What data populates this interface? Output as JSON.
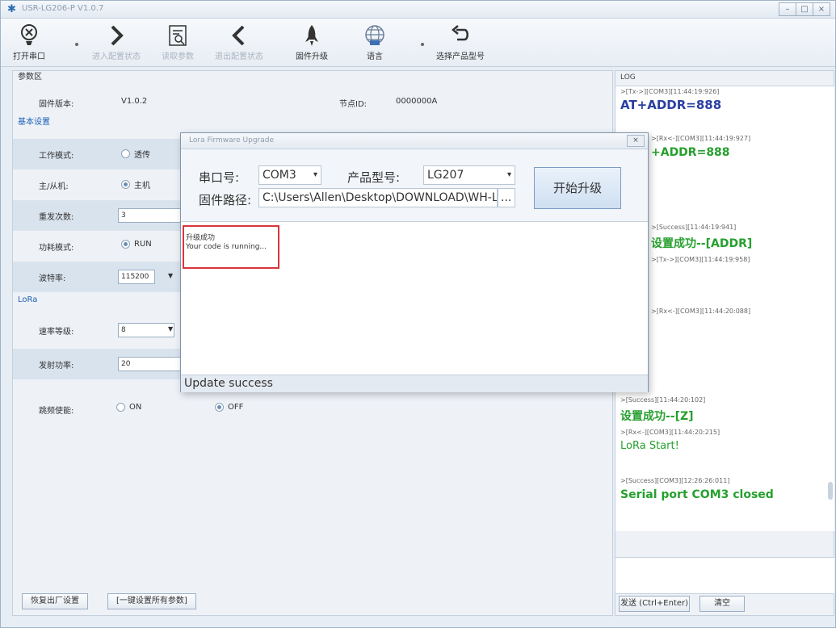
{
  "window": {
    "title": "USR-LG206-P V1.0.7",
    "buttons": [
      "–",
      "□",
      "×"
    ]
  },
  "toolbar": {
    "items": [
      {
        "label": "打开串口",
        "icon": "serial-port-icon",
        "enabled": true
      },
      {
        "label": "进入配置状态",
        "icon": "chevron-right-icon",
        "enabled": false
      },
      {
        "label": "读取参数",
        "icon": "read-params-icon",
        "enabled": false
      },
      {
        "label": "退出配置状态",
        "icon": "chevron-left-icon",
        "enabled": false
      },
      {
        "label": "固件升级",
        "icon": "rocket-icon",
        "enabled": true
      },
      {
        "label": "语言",
        "icon": "globe-icon",
        "enabled": true
      },
      {
        "label": "选择产品型号",
        "icon": "return-arrow-icon",
        "enabled": true
      }
    ]
  },
  "params": {
    "section_title": "参数区",
    "firmware_label": "固件版本:",
    "firmware_value": "V1.0.2",
    "node_id_label": "节点ID:",
    "node_id_value": "0000000A"
  },
  "basic": {
    "section_title": "基本设置",
    "work_mode_label": "工作模式:",
    "work_mode_option": "透传",
    "master_slave_label": "主/从机:",
    "master_option": "主机",
    "retry_label": "重发次数:",
    "retry_value": "3",
    "power_mode_label": "功耗模式:",
    "power_mode_option": "RUN",
    "baud_label": "波特率:",
    "baud_value": "115200"
  },
  "lora": {
    "section_title": "LoRa",
    "speed_label": "速率等级:",
    "speed_value": "8",
    "tx_power_label": "发射功率:",
    "tx_power_value": "20",
    "fh_label": "跳频使能:",
    "fh_on": "ON",
    "fh_off": "OFF"
  },
  "bottom_buttons": {
    "factory": "恢复出厂设置",
    "set_all": "[一键设置所有参数]"
  },
  "log": {
    "header": "LOG",
    "lines": [
      {
        "type": "meta",
        "text": ">[Tx->][COM3][11:44:19:926]"
      },
      {
        "type": "tx",
        "text": "AT+ADDR=888"
      },
      {
        "type": "meta",
        "text": ">[Rx<-][COM3][11:44:19:927]"
      },
      {
        "type": "green",
        "text": "+ADDR=888"
      },
      {
        "type": "meta",
        "text": ">[Success][11:44:19:941]"
      },
      {
        "type": "green",
        "text": "设置成功--[ADDR]"
      },
      {
        "type": "meta",
        "text": ">[Tx->][COM3][11:44:19:958]"
      },
      {
        "type": "meta",
        "text": ">[Rx<-][COM3][11:44:20:088]"
      },
      {
        "type": "meta",
        "text": ">[Success][11:44:20:102]"
      },
      {
        "type": "green",
        "text": "设置成功--[Z]"
      },
      {
        "type": "meta",
        "text": ">[Rx<-][COM3][11:44:20:215]"
      },
      {
        "type": "green-n",
        "text": "LoRa Start!"
      },
      {
        "type": "meta",
        "text": ">[Success][COM3][12:26:26:011]"
      },
      {
        "type": "green",
        "text": "Serial port COM3 closed"
      }
    ],
    "send_button": "发送 (Ctrl+Enter)",
    "clear_button": "清空"
  },
  "dialog": {
    "title": "Lora Firmware Upgrade",
    "close": "×",
    "port_label": "串口号:",
    "port_value": "COM3",
    "model_label": "产品型号:",
    "model_value": "LG207",
    "path_label": "固件路径:",
    "path_value": "C:\\Users\\Allen\\Desktop\\DOWNLOAD\\WH-L(",
    "path_browse": "...",
    "start_button": "开始升级",
    "output_line1": "升级成功",
    "output_line2": "Your code is running...",
    "status": "Update success"
  },
  "colors": {
    "accent_blue": "#2a3fa0",
    "success_green": "#26a02e",
    "highlight_red": "#d9363e"
  }
}
